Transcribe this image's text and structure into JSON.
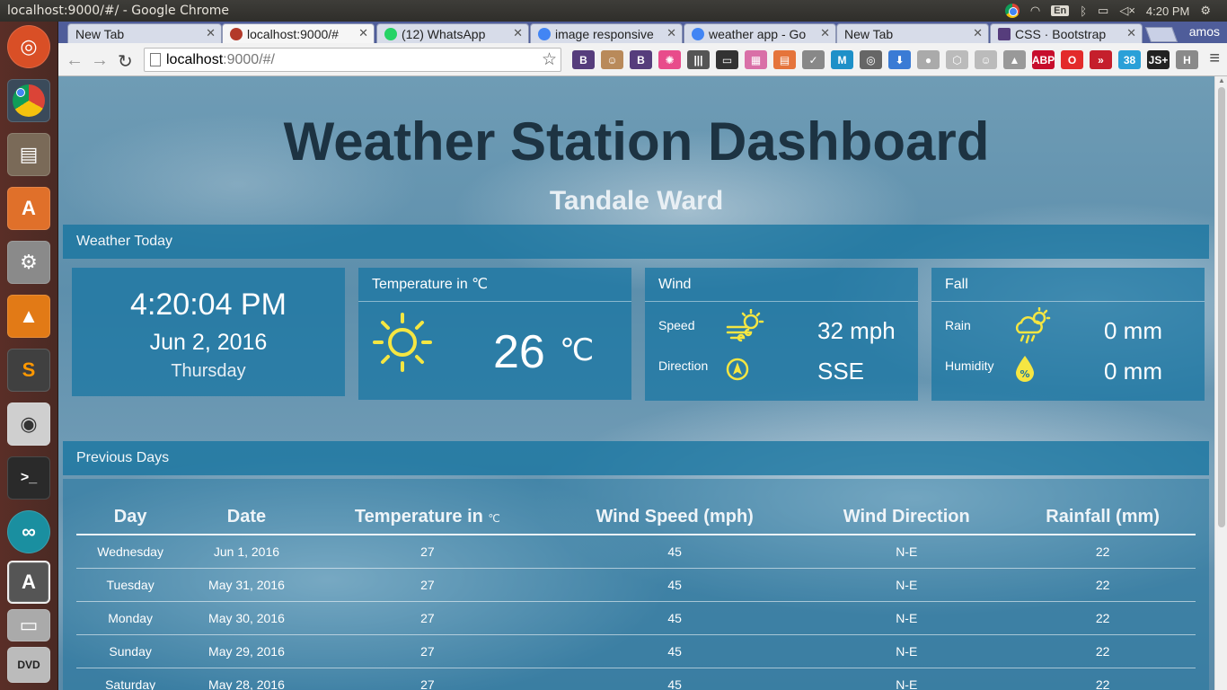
{
  "system": {
    "window_title": "localhost:9000/#/ - Google Chrome",
    "keyboard": "En",
    "clock": "4:20 PM",
    "user": "amos"
  },
  "launcher": [
    "ubuntu-icon",
    "chrome-icon",
    "files-icon",
    "software-center-icon",
    "system-settings-icon",
    "vlc-icon",
    "sublime-text-icon",
    "speaker-icon",
    "terminal-icon",
    "arduino-icon",
    "software-updater-icon",
    "drive-icon",
    "dvd-icon"
  ],
  "tabs": [
    {
      "label": "New Tab",
      "icon_color": "#d7dce9"
    },
    {
      "label": "localhost:9000/#",
      "icon_color": "#b33a2a"
    },
    {
      "label": "(12) WhatsApp",
      "icon_color": "#25d366"
    },
    {
      "label": "image responsive",
      "icon_color": "#4285f4"
    },
    {
      "label": "weather app - Go",
      "icon_color": "#4285f4"
    },
    {
      "label": "New Tab",
      "icon_color": "#d7dce9"
    },
    {
      "label": "CSS · Bootstrap",
      "icon_color": "#563d7c"
    }
  ],
  "address_bar": {
    "host": "localhost",
    "rest": ":9000/#/"
  },
  "extensions": [
    {
      "label": "B",
      "color": "#563d7c"
    },
    {
      "label": "☺",
      "color": "#b98a5a"
    },
    {
      "label": "B",
      "color": "#563d7c"
    },
    {
      "label": "✺",
      "color": "#e84c8b"
    },
    {
      "label": "|||",
      "color": "#555"
    },
    {
      "label": "▭",
      "color": "#333"
    },
    {
      "label": "▦",
      "color": "#d96fa7"
    },
    {
      "label": "▤",
      "color": "#e5743b"
    },
    {
      "label": "✓",
      "color": "#888"
    },
    {
      "label": "M",
      "color": "#1e90c8"
    },
    {
      "label": "◎",
      "color": "#666"
    },
    {
      "label": "⬇",
      "color": "#3a7bd5"
    },
    {
      "label": "●",
      "color": "#aaa"
    },
    {
      "label": "⬡",
      "color": "#bbb"
    },
    {
      "label": "☺",
      "color": "#bbb"
    },
    {
      "label": "▲",
      "color": "#999"
    },
    {
      "label": "ABP",
      "color": "#c70d2c"
    },
    {
      "label": "O",
      "color": "#e32b2b"
    },
    {
      "label": "»",
      "color": "#c51f2c"
    },
    {
      "label": "38",
      "color": "#2aa0d8"
    },
    {
      "label": "JS+",
      "color": "#222"
    },
    {
      "label": "H",
      "color": "#8a8a8a"
    }
  ],
  "dashboard": {
    "title": "Weather Station Dashboard",
    "location": "Tandale Ward",
    "today_header": "Weather Today",
    "time": "4:20:04 PM",
    "date": "Jun 2, 2016",
    "weekday": "Thursday",
    "temp_header": "Temperature in ℃",
    "temp_value": "26",
    "temp_unit": "℃",
    "wind_header": "Wind",
    "speed_label": "Speed",
    "speed_value": "32 mph",
    "direction_label": "Direction",
    "direction_value": "SSE",
    "fall_header": "Fall",
    "rain_label": "Rain",
    "rain_value": "0 mm",
    "humidity_label": "Humidity",
    "humidity_value": "0 mm",
    "previous_header": "Previous Days"
  },
  "table": {
    "headers": [
      "Day",
      "Date",
      "Temperature in",
      "Wind Speed (mph)",
      "Wind Direction",
      "Rainfall (mm)"
    ],
    "temp_unit": "℃",
    "rows": [
      [
        "Wednesday",
        "Jun 1, 2016",
        "27",
        "45",
        "N-E",
        "22"
      ],
      [
        "Tuesday",
        "May 31, 2016",
        "27",
        "45",
        "N-E",
        "22"
      ],
      [
        "Monday",
        "May 30, 2016",
        "27",
        "45",
        "N-E",
        "22"
      ],
      [
        "Sunday",
        "May 29, 2016",
        "27",
        "45",
        "N-E",
        "22"
      ],
      [
        "Saturday",
        "May 28, 2016",
        "27",
        "45",
        "N-E",
        "22"
      ]
    ]
  },
  "colors": {
    "panel": "#1774a0",
    "title": "#1d3342",
    "icon": "#f5e642"
  }
}
